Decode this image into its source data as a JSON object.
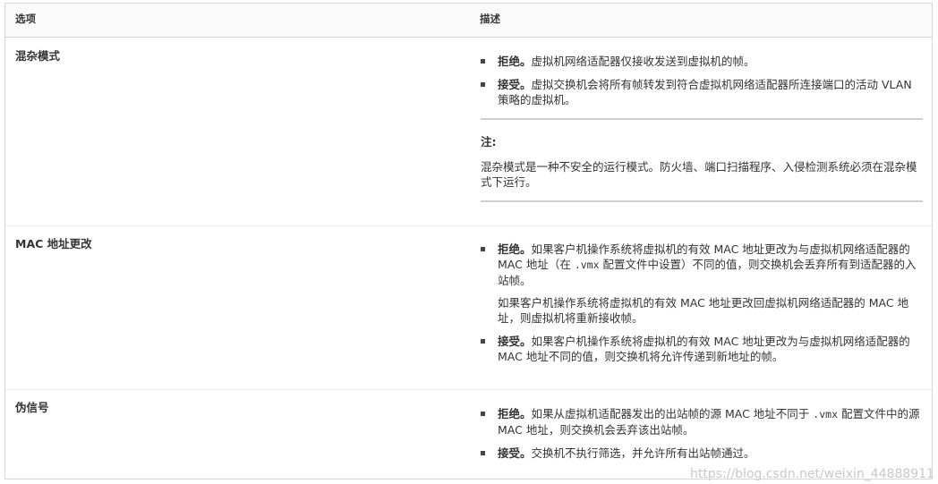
{
  "table": {
    "headers": {
      "option": "选项",
      "description": "描述"
    },
    "rows": [
      {
        "name": "混杂模式",
        "bullets": [
          {
            "bold": "拒绝。",
            "text": "虚拟机网络适配器仅接收发送到虚拟机的帧。"
          },
          {
            "bold": "接受。",
            "text": "虚拟交换机会将所有帧转发到符合虚拟机网络适配器所连接端口的活动 VLAN 策略的虚拟机。"
          }
        ],
        "note": {
          "title": "注:",
          "text": "混杂模式是一种不安全的运行模式。防火墙、端口扫描程序、入侵检测系统必须在混杂模式下运行。"
        }
      },
      {
        "name": "MAC 地址更改",
        "bullets": [
          {
            "bold": "拒绝。",
            "text_pre": "如果客户机操作系统将虚拟机的有效 MAC 地址更改为与虚拟机网络适配器的 MAC 地址（在",
            "code": ".vmx",
            "text_post": "配置文件中设置）不同的值，则交换机会丢弃所有到适配器的入站帧。",
            "para": "如果客户机操作系统将虚拟机的有效 MAC 地址更改回虚拟机网络适配器的 MAC 地址，则虚拟机将重新接收帧。"
          },
          {
            "bold": "接受。",
            "text": "如果客户机操作系统将虚拟机的有效 MAC 地址更改为与虚拟机网络适配器的 MAC 地址不同的值，则交换机将允许传递到新地址的帧。"
          }
        ]
      },
      {
        "name": "伪信号",
        "bullets": [
          {
            "bold": "拒绝。",
            "text_pre": "如果从虚拟机适配器发出的出站帧的源 MAC 地址不同于",
            "code": ".vmx",
            "text_post": "配置文件中的源 MAC 地址，则交换机会丢弃该出站帧。"
          },
          {
            "bold": "接受。",
            "text": "交换机不执行筛选，并允许所有出站帧通过。"
          }
        ]
      }
    ]
  },
  "watermark": "https://blog.csdn.net/weixin_44888911",
  "colors": {
    "border": "#d6d6d6",
    "header_bg": "#fafafa",
    "text": "#333333",
    "rule": "#cfcfcf"
  }
}
